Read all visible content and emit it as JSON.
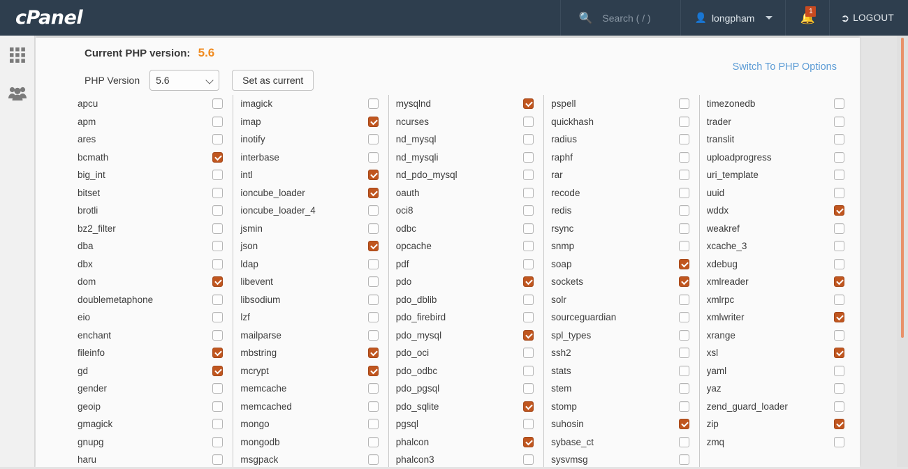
{
  "header": {
    "logo_text": "cPanel",
    "search": {
      "icon": "search-icon",
      "placeholder": "Search ( / )",
      "value": ""
    },
    "user": {
      "icon": "user-icon",
      "name": "longpham",
      "caret": "chevron-down-icon"
    },
    "notifications": {
      "icon": "bell-icon",
      "count": "1",
      "badge_color": "#c84a20"
    },
    "logout": {
      "icon": "logout-icon",
      "label": "LOGOUT"
    },
    "bar_color": "#2e3e4e"
  },
  "sidebar": {
    "items": [
      {
        "name": "sidebar-item-apps",
        "icon": "grid-icon"
      },
      {
        "name": "sidebar-item-users",
        "icon": "users-icon"
      }
    ]
  },
  "php_version": {
    "current_label": "Current PHP version:",
    "current_value": "5.6",
    "current_value_color": "#f08a1e",
    "select_label": "PHP Version",
    "selected_option": "5.6",
    "options": [
      "5.6"
    ],
    "set_button_label": "Set as current",
    "switch_link_label": "Switch To PHP Options",
    "switch_link_color": "#5b9bd5"
  },
  "extensions": {
    "checked_color": "#c0561f",
    "columns": [
      [
        {
          "name": "apcu",
          "checked": false
        },
        {
          "name": "apm",
          "checked": false
        },
        {
          "name": "ares",
          "checked": false
        },
        {
          "name": "bcmath",
          "checked": true
        },
        {
          "name": "big_int",
          "checked": false
        },
        {
          "name": "bitset",
          "checked": false
        },
        {
          "name": "brotli",
          "checked": false
        },
        {
          "name": "bz2_filter",
          "checked": false
        },
        {
          "name": "dba",
          "checked": false
        },
        {
          "name": "dbx",
          "checked": false
        },
        {
          "name": "dom",
          "checked": true
        },
        {
          "name": "doublemetaphone",
          "checked": false
        },
        {
          "name": "eio",
          "checked": false
        },
        {
          "name": "enchant",
          "checked": false
        },
        {
          "name": "fileinfo",
          "checked": true
        },
        {
          "name": "gd",
          "checked": true
        },
        {
          "name": "gender",
          "checked": false
        },
        {
          "name": "geoip",
          "checked": false
        },
        {
          "name": "gmagick",
          "checked": false
        },
        {
          "name": "gnupg",
          "checked": false
        },
        {
          "name": "haru",
          "checked": false
        }
      ],
      [
        {
          "name": "imagick",
          "checked": false
        },
        {
          "name": "imap",
          "checked": true
        },
        {
          "name": "inotify",
          "checked": false
        },
        {
          "name": "interbase",
          "checked": false
        },
        {
          "name": "intl",
          "checked": true
        },
        {
          "name": "ioncube_loader",
          "checked": true
        },
        {
          "name": "ioncube_loader_4",
          "checked": false
        },
        {
          "name": "jsmin",
          "checked": false
        },
        {
          "name": "json",
          "checked": true
        },
        {
          "name": "ldap",
          "checked": false
        },
        {
          "name": "libevent",
          "checked": false
        },
        {
          "name": "libsodium",
          "checked": false
        },
        {
          "name": "lzf",
          "checked": false
        },
        {
          "name": "mailparse",
          "checked": false
        },
        {
          "name": "mbstring",
          "checked": true
        },
        {
          "name": "mcrypt",
          "checked": true
        },
        {
          "name": "memcache",
          "checked": false
        },
        {
          "name": "memcached",
          "checked": false
        },
        {
          "name": "mongo",
          "checked": false
        },
        {
          "name": "mongodb",
          "checked": false
        },
        {
          "name": "msgpack",
          "checked": false
        }
      ],
      [
        {
          "name": "mysqlnd",
          "checked": true
        },
        {
          "name": "ncurses",
          "checked": false
        },
        {
          "name": "nd_mysql",
          "checked": false
        },
        {
          "name": "nd_mysqli",
          "checked": false
        },
        {
          "name": "nd_pdo_mysql",
          "checked": false
        },
        {
          "name": "oauth",
          "checked": false
        },
        {
          "name": "oci8",
          "checked": false
        },
        {
          "name": "odbc",
          "checked": false
        },
        {
          "name": "opcache",
          "checked": false
        },
        {
          "name": "pdf",
          "checked": false
        },
        {
          "name": "pdo",
          "checked": true
        },
        {
          "name": "pdo_dblib",
          "checked": false
        },
        {
          "name": "pdo_firebird",
          "checked": false
        },
        {
          "name": "pdo_mysql",
          "checked": true
        },
        {
          "name": "pdo_oci",
          "checked": false
        },
        {
          "name": "pdo_odbc",
          "checked": false
        },
        {
          "name": "pdo_pgsql",
          "checked": false
        },
        {
          "name": "pdo_sqlite",
          "checked": true
        },
        {
          "name": "pgsql",
          "checked": false
        },
        {
          "name": "phalcon",
          "checked": true
        },
        {
          "name": "phalcon3",
          "checked": false
        }
      ],
      [
        {
          "name": "pspell",
          "checked": false
        },
        {
          "name": "quickhash",
          "checked": false
        },
        {
          "name": "radius",
          "checked": false
        },
        {
          "name": "raphf",
          "checked": false
        },
        {
          "name": "rar",
          "checked": false
        },
        {
          "name": "recode",
          "checked": false
        },
        {
          "name": "redis",
          "checked": false
        },
        {
          "name": "rsync",
          "checked": false
        },
        {
          "name": "snmp",
          "checked": false
        },
        {
          "name": "soap",
          "checked": true
        },
        {
          "name": "sockets",
          "checked": true
        },
        {
          "name": "solr",
          "checked": false
        },
        {
          "name": "sourceguardian",
          "checked": false
        },
        {
          "name": "spl_types",
          "checked": false
        },
        {
          "name": "ssh2",
          "checked": false
        },
        {
          "name": "stats",
          "checked": false
        },
        {
          "name": "stem",
          "checked": false
        },
        {
          "name": "stomp",
          "checked": false
        },
        {
          "name": "suhosin",
          "checked": true
        },
        {
          "name": "sybase_ct",
          "checked": false
        },
        {
          "name": "sysvmsg",
          "checked": false
        }
      ],
      [
        {
          "name": "timezonedb",
          "checked": false
        },
        {
          "name": "trader",
          "checked": false
        },
        {
          "name": "translit",
          "checked": false
        },
        {
          "name": "uploadprogress",
          "checked": false
        },
        {
          "name": "uri_template",
          "checked": false
        },
        {
          "name": "uuid",
          "checked": false
        },
        {
          "name": "wddx",
          "checked": true
        },
        {
          "name": "weakref",
          "checked": false
        },
        {
          "name": "xcache_3",
          "checked": false
        },
        {
          "name": "xdebug",
          "checked": false
        },
        {
          "name": "xmlreader",
          "checked": true
        },
        {
          "name": "xmlrpc",
          "checked": false
        },
        {
          "name": "xmlwriter",
          "checked": true
        },
        {
          "name": "xrange",
          "checked": false
        },
        {
          "name": "xsl",
          "checked": true
        },
        {
          "name": "yaml",
          "checked": false
        },
        {
          "name": "yaz",
          "checked": false
        },
        {
          "name": "zend_guard_loader",
          "checked": false
        },
        {
          "name": "zip",
          "checked": true
        },
        {
          "name": "zmq",
          "checked": false
        }
      ]
    ]
  }
}
